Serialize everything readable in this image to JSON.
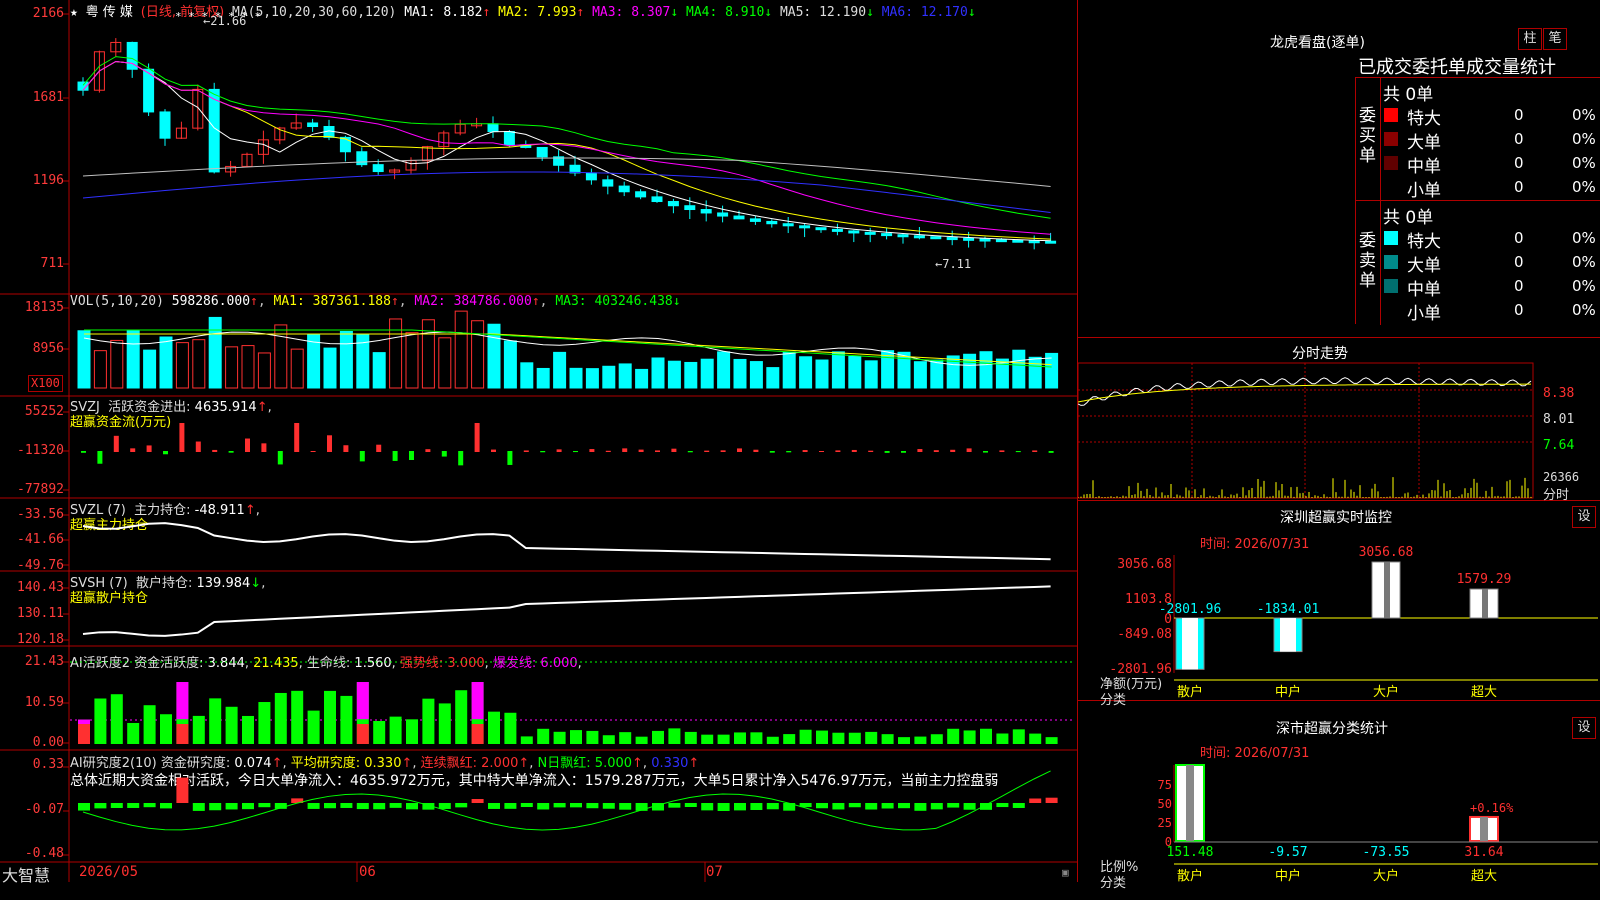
{
  "colors": {
    "up": "#ff3030",
    "down": "#00ffff",
    "frame": "#b00000",
    "bg": "#000000",
    "ma1": "#ffffff",
    "ma2": "#ffff00",
    "ma3": "#ff00ff",
    "ma4": "#00ff00",
    "ma5": "#c0c0c0",
    "ma6": "#3030ff"
  },
  "main": {
    "star": "★",
    "stock_name": "粤 传 媒",
    "period": "(日线, 前复权)",
    "ma_header": "MA(5,10,20,30,60,120)",
    "ma": [
      {
        "label": "MA1: ",
        "value": "8.182",
        "arrow": "↑"
      },
      {
        "label": "MA2: ",
        "value": "7.993",
        "arrow": "↑"
      },
      {
        "label": "MA3: ",
        "value": "8.307",
        "arrow": "↓"
      },
      {
        "label": "MA4: ",
        "value": "8.910",
        "arrow": "↓"
      },
      {
        "label": "MA5: ",
        "value": "12.190",
        "arrow": "↓"
      },
      {
        "label": "MA6: ",
        "value": "12.170",
        "arrow": "↓"
      }
    ],
    "axis": [
      "2166",
      "1681",
      "1196",
      "711"
    ],
    "high_note": "←21.66",
    "low_note": "←7.11",
    "stars": "*  *   *    *  *  *  *"
  },
  "vol": {
    "header": "VOL(5,10,20)",
    "value": "598286.000",
    "arrow": "↑",
    "ma": [
      {
        "label": "MA1: ",
        "value": "387361.188",
        "arrow": "↑"
      },
      {
        "label": "MA2: ",
        "value": "384786.000",
        "arrow": "↑"
      },
      {
        "label": "MA3: ",
        "value": "403246.438",
        "arrow": "↓"
      }
    ],
    "axis": [
      "18135",
      "8956"
    ],
    "unit": "X100"
  },
  "svzj": {
    "header": "SVZJ",
    "title": "活跃资金进出: ",
    "value": "4635.914",
    "arrow": "↑",
    "sub": "超赢资金流(万元)",
    "axis": [
      "55252",
      "-11320",
      "-77892"
    ]
  },
  "svzl": {
    "header": "SVZL (7)",
    "title": "主力持仓: ",
    "value": "-48.911",
    "arrow": "↑",
    "sub": "超赢主力持仓",
    "axis": [
      "-33.56",
      "-41.66",
      "-49.76"
    ]
  },
  "svsh": {
    "header": "SVSH (7)",
    "title": "散户持仓: ",
    "value": "139.984",
    "arrow": "↓",
    "sub": "超赢散户持仓",
    "axis": [
      "140.43",
      "130.11",
      "120.18"
    ]
  },
  "ai1": {
    "header": "AI活跃度2",
    "t1": "资金活跃度: ",
    "v1": "3.844",
    "v2": "21.435",
    "t3": "生命线: ",
    "v3": "1.560",
    "t4": "强势线: ",
    "v4": "3.000",
    "t5": "爆发线: ",
    "v5": "6.000",
    "axis": [
      "21.43",
      "10.59",
      "0.00"
    ]
  },
  "ai2": {
    "header": "AI研究度2(10)",
    "t1": "资金研究度: ",
    "v1": "0.074",
    "t2": "平均研究度: ",
    "v2": "0.330",
    "t3": "连续飘红: ",
    "v3": "2.000",
    "t4": "N日飘红: ",
    "v4": "5.000",
    "v5": "0.330",
    "summary": "总体近期大资金相对活跃，今日大单净流入：4635.972万元，其中特大单净流入：1579.287万元，大单5日累计净入5476.97万元，当前主力控盘弱",
    "axis": [
      "0.33",
      "-0.07",
      "-0.48"
    ]
  },
  "bottom": {
    "brand": "大智慧",
    "dates": [
      "2026/05",
      "06",
      "07"
    ]
  },
  "longhu": {
    "title": "龙虎看盘(逐单)",
    "btn1": "柱",
    "btn2": "笔",
    "tabs": "已成交委托单成交量统计",
    "buy": {
      "side": "委买单",
      "total": "共 0单",
      "rows": [
        {
          "name": "特大",
          "count": "0",
          "pct": "0%",
          "color": "#ff0000"
        },
        {
          "name": "大单",
          "count": "0",
          "pct": "0%",
          "color": "#8b0000"
        },
        {
          "name": "中单",
          "count": "0",
          "pct": "0%",
          "color": "#600000"
        },
        {
          "name": "小单",
          "count": "0",
          "pct": "0%",
          "color": ""
        }
      ]
    },
    "sell": {
      "side": "委卖单",
      "total": "共 0单",
      "rows": [
        {
          "name": "特大",
          "count": "0",
          "pct": "0%",
          "color": "#00ffff"
        },
        {
          "name": "大单",
          "count": "0",
          "pct": "0%",
          "color": "#008b8b"
        },
        {
          "name": "中单",
          "count": "0",
          "pct": "0%",
          "color": "#006f6f"
        },
        {
          "name": "小单",
          "count": "0",
          "pct": "0%",
          "color": ""
        }
      ]
    }
  },
  "fenshi": {
    "title": "分时走势",
    "axis": [
      "8.38",
      "8.01",
      "7.64"
    ],
    "vol_label": "26366",
    "type_label": "分时"
  },
  "monitor": {
    "title": "深圳超赢实时监控",
    "set": "设",
    "time": "时间: 2026/07/31",
    "axis": [
      "3056.68",
      "1103.8",
      "0",
      "-849.08",
      "-2801.96"
    ],
    "ylabel": "净额(万元)",
    "xlabel": "分类",
    "bars": [
      {
        "cat": "散户",
        "value": "-2801.96"
      },
      {
        "cat": "中户",
        "value": "-1834.01"
      },
      {
        "cat": "大户",
        "value": "3056.68"
      },
      {
        "cat": "超大",
        "value": "1579.29"
      }
    ]
  },
  "classify": {
    "title": "深市超赢分类统计",
    "set": "设",
    "time": "时间: 2026/07/31",
    "axis": [
      "75",
      "50",
      "25",
      "0"
    ],
    "ylabel": "比例%",
    "xlabel": "分类",
    "note": "+0.16%",
    "bars": [
      {
        "cat": "散户",
        "value": "151.48"
      },
      {
        "cat": "中户",
        "value": "-9.57"
      },
      {
        "cat": "大户",
        "value": "-73.55"
      },
      {
        "cat": "超大",
        "value": "31.64"
      }
    ]
  }
}
